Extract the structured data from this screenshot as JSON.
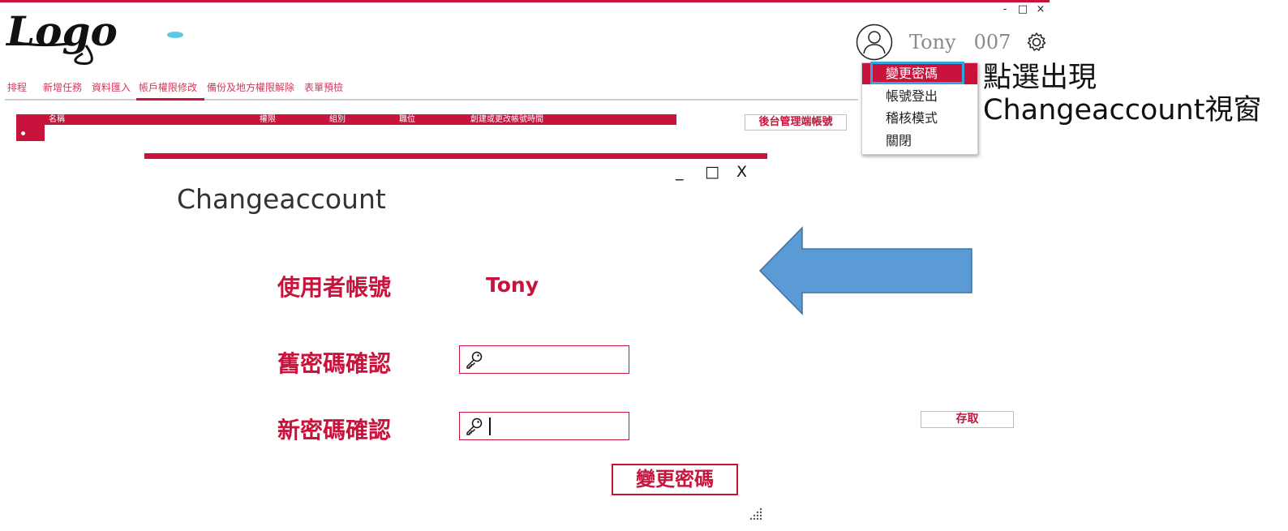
{
  "app": {
    "logo_text": "Logo",
    "window_controls": {
      "minimize": "-",
      "maximize": "□",
      "close": "×"
    }
  },
  "user": {
    "name": "Tony",
    "id": "007"
  },
  "dropdown": {
    "items": [
      {
        "label": "變更密碼",
        "active": true
      },
      {
        "label": "帳號登出",
        "active": false
      },
      {
        "label": "稽核模式",
        "active": false
      },
      {
        "label": "關閉",
        "active": false
      }
    ]
  },
  "annotation": {
    "line1": "點選出現",
    "line2": "Changeaccount視窗"
  },
  "nav": {
    "tabs": [
      {
        "label": "排程"
      },
      {
        "label": "新增任務"
      },
      {
        "label": "資料匯入"
      },
      {
        "label": "帳戶權限修改",
        "active": true
      },
      {
        "label": "備份及地方權限解除"
      },
      {
        "label": "表單預檢"
      }
    ]
  },
  "table": {
    "columns": [
      "名稱",
      "權限",
      "組別",
      "職位",
      "創建或更改帳號時間"
    ]
  },
  "admin_button": "後台管理端帳號",
  "dialog": {
    "title": "Changeaccount",
    "controls": {
      "minimize": "_",
      "maximize": "□",
      "close": "X"
    },
    "user_label": "使用者帳號",
    "user_value": "Tony",
    "old_pw_label": "舊密碼確認",
    "new_pw_label": "新密碼確認",
    "submit_label": "變更密碼"
  },
  "save_button": "存取",
  "colors": {
    "accent": "#c8143c",
    "arrow_fill": "#5b9bd5",
    "highlight": "#31a6de"
  }
}
